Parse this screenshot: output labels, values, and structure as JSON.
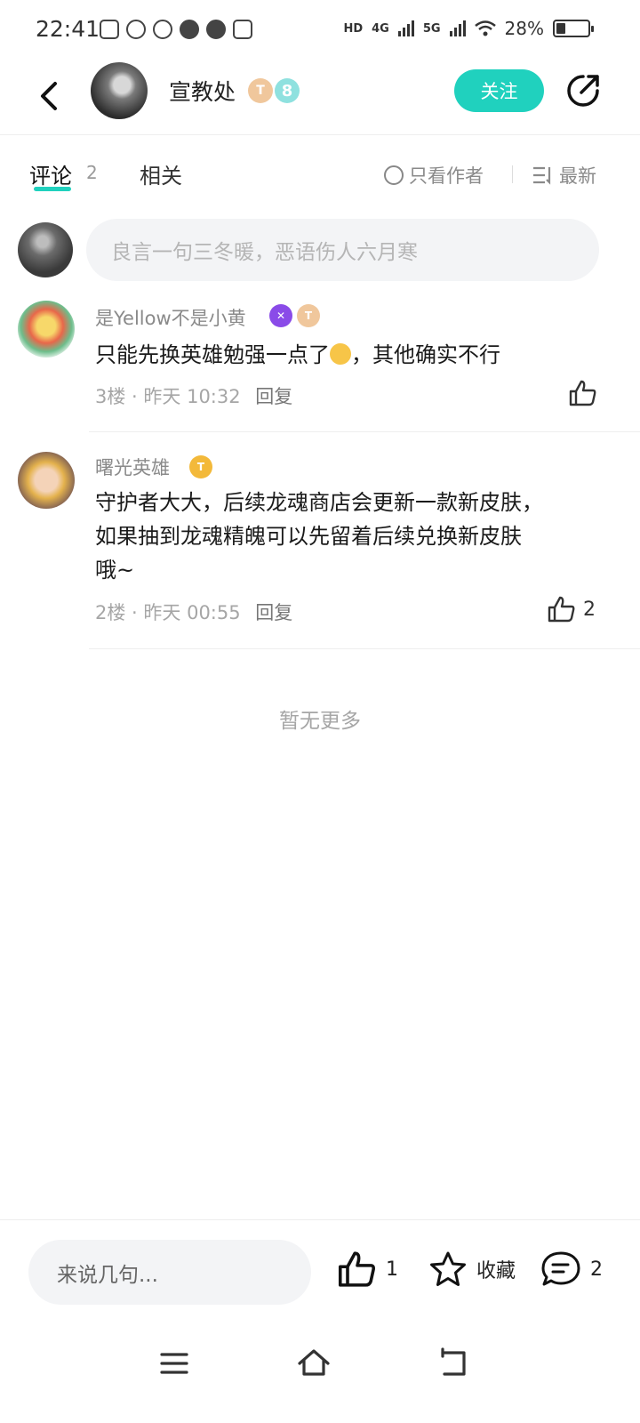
{
  "status_bar": {
    "time": "22:41",
    "network_hd": "HD",
    "network_4g": "4G",
    "network_5g": "5G",
    "battery": "28%",
    "battery_fraction": 0.28
  },
  "header": {
    "author_name": "宣教处",
    "author_level_badge": "T",
    "author_vip_badge": "8",
    "follow_label": "关注"
  },
  "tabs": {
    "comments_label": "评论",
    "comments_count": "2",
    "related_label": "相关",
    "author_only_label": "只看作者",
    "sort_label": "最新"
  },
  "comment_input": {
    "placeholder": "良言一句三冬暖，恶语伤人六月寒"
  },
  "comments": [
    {
      "user": "是Yellow不是小黄",
      "text_before_emoji": "只能先换英雄勉强一点了",
      "text_after_emoji": "，其他确实不行",
      "floor": "3楼",
      "time": "昨天 10:32",
      "reply_label": "回复",
      "likes": ""
    },
    {
      "user": "曙光英雄",
      "text_line1": "守护者大大，后续龙魂商店会更新一款新皮肤，",
      "text_line2": "如果抽到龙魂精魄可以先留着后续兑换新皮肤",
      "text_line3": "哦~",
      "floor": "2楼",
      "time": "昨天 00:55",
      "reply_label": "回复",
      "likes": "2"
    }
  ],
  "no_more_label": "暂无更多",
  "bottom_bar": {
    "input_placeholder": "来说几句...",
    "like_count": "1",
    "favorite_label": "收藏",
    "comment_count": "2"
  },
  "colors": {
    "accent": "#20d1be",
    "text_primary": "#1a1a1a",
    "text_secondary": "#8a8a8a"
  }
}
